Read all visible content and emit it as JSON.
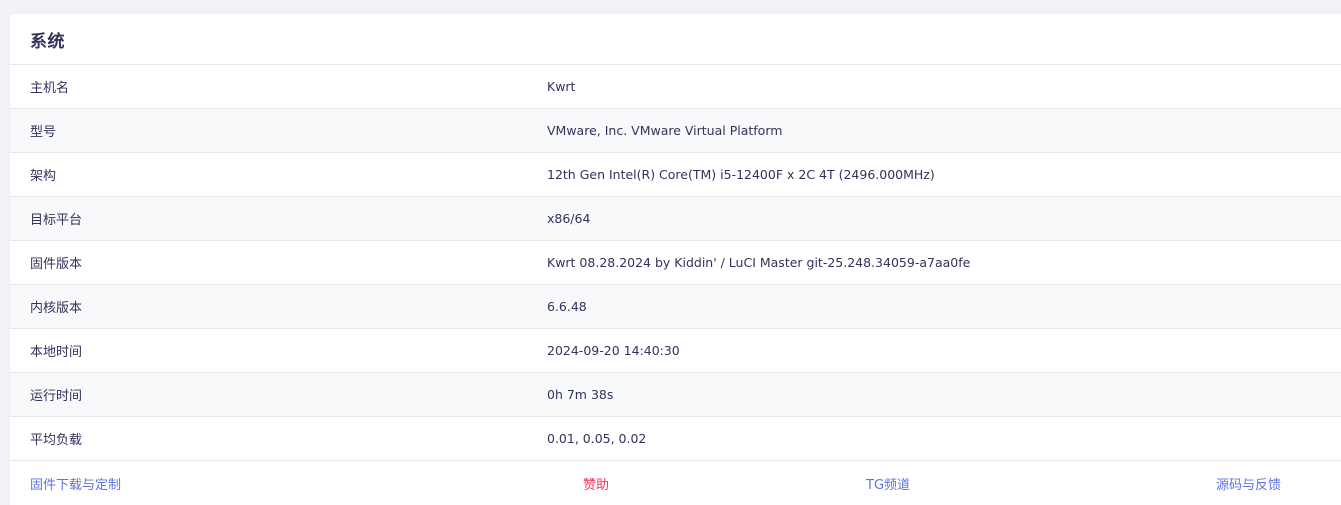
{
  "section": {
    "title": "系统"
  },
  "rows": [
    {
      "label": "主机名",
      "value": "Kwrt"
    },
    {
      "label": "型号",
      "value": "VMware, Inc. VMware Virtual Platform"
    },
    {
      "label": "架构",
      "value": "12th Gen Intel(R) Core(TM) i5-12400F x 2C 4T (2496.000MHz)"
    },
    {
      "label": "目标平台",
      "value": "x86/64"
    },
    {
      "label": "固件版本",
      "value": "Kwrt 08.28.2024 by Kiddin' / LuCI Master git-25.248.34059-a7aa0fe"
    },
    {
      "label": "内核版本",
      "value": "6.6.48"
    },
    {
      "label": "本地时间",
      "value": "2024-09-20 14:40:30"
    },
    {
      "label": "运行时间",
      "value": "0h 7m 38s"
    },
    {
      "label": "平均负载",
      "value": "0.01, 0.05, 0.02"
    }
  ],
  "footer": {
    "links": [
      {
        "label": "固件下载与定制",
        "color": "#5e72e4"
      },
      {
        "label": "赞助",
        "color": "#f5365c"
      },
      {
        "label": "TG频道",
        "color": "#5e72e4"
      },
      {
        "label": "源码与反馈",
        "color": "#5e72e4"
      }
    ]
  }
}
